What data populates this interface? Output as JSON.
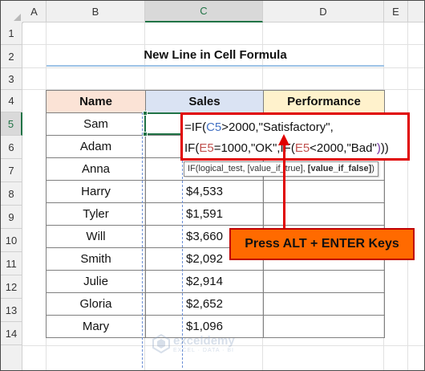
{
  "sheet": {
    "columns": [
      "A",
      "B",
      "C",
      "D",
      "E"
    ],
    "active_column": "C",
    "rows": [
      "1",
      "2",
      "3",
      "4",
      "5",
      "6",
      "7",
      "8",
      "9",
      "10",
      "11",
      "12",
      "13",
      "14"
    ],
    "active_row": "5"
  },
  "title": "New Line in Cell Formula",
  "table": {
    "headers": {
      "name": "Name",
      "sales": "Sales",
      "performance": "Performance"
    },
    "rows": [
      {
        "name": "Sam",
        "sales": ""
      },
      {
        "name": "Adam",
        "sales": ""
      },
      {
        "name": "Anna",
        "sales": ""
      },
      {
        "name": "Harry",
        "sales": "$4,533"
      },
      {
        "name": "Tyler",
        "sales": "$1,591"
      },
      {
        "name": "Will",
        "sales": "$3,660"
      },
      {
        "name": "Smith",
        "sales": "$2,092"
      },
      {
        "name": "Julie",
        "sales": "$2,914"
      },
      {
        "name": "Gloria",
        "sales": "$2,652"
      },
      {
        "name": "Mary",
        "sales": "$1,096"
      }
    ]
  },
  "formula": {
    "line1": {
      "a": "=IF(",
      "ref": "C5",
      "b": ">2000,\"Satisfactory\","
    },
    "line2": {
      "a": "IF(",
      "ref1": "E5",
      "b": "=1000,\"OK\",",
      "c": "IF(",
      "ref2": "E5",
      "d": "<2000,\"Bad\"",
      "e": ")",
      "f": "))"
    },
    "tooltip": {
      "func": "IF(logical_test, [value_if_true], ",
      "bold": "[value_if_false]",
      "end": ")"
    }
  },
  "callout": "Press ALT + ENTER Keys",
  "watermark": {
    "name": "exceldemy",
    "tagline": "EXCEL · DATA · BI"
  },
  "colors": {
    "accent": "#217346",
    "callout": "#ff6a00",
    "highlight_border": "#e00000"
  }
}
